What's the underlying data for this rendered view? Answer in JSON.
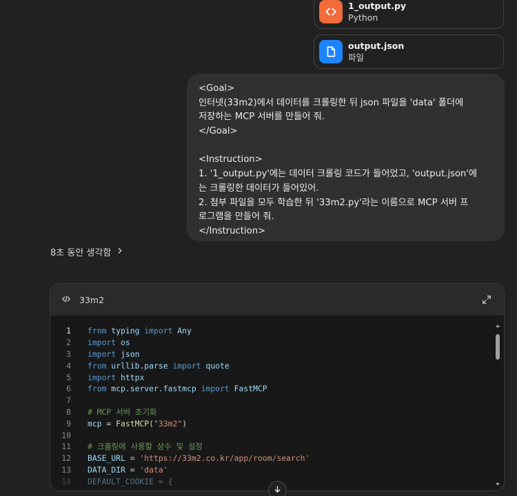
{
  "attachments": [
    {
      "name": "1_output.py",
      "type": "Python",
      "icon": "code-icon",
      "color": "#f26b3a"
    },
    {
      "name": "output.json",
      "type": "파일",
      "icon": "document-icon",
      "color": "#1d84ff"
    }
  ],
  "message": {
    "lines": [
      "<Goal>",
      "인터넷(33m2)에서 데이터를 크롤링한 뒤 json 파일을 'data' 폴더에",
      "저장하는 MCP 서버를 만들어 줘.",
      "</Goal>",
      "",
      "<Instruction>",
      "1. '1_output.py'에는 데이터 크롤링 코드가 들어었고, 'output.json'에",
      "는 크롤링한 데이터가 들어있어.",
      "2. 첨부 파일을 모두 학습한 뒤 '33m2.py'라는 이름으로 MCP 서버 프",
      "로그램을 만들어 줘.",
      "</Instruction>"
    ]
  },
  "thought": {
    "label": "8초 동안 생각함",
    "icon": "chevron-right-icon"
  },
  "code_block": {
    "title": "33m2",
    "header_icon": "code-icon",
    "expand_icon": "expand-icon",
    "lines": [
      {
        "num": "1",
        "text": "from typing import Any"
      },
      {
        "num": "2",
        "text": "import os"
      },
      {
        "num": "3",
        "text": "import json"
      },
      {
        "num": "4",
        "text": "from urllib.parse import quote"
      },
      {
        "num": "5",
        "text": "import httpx"
      },
      {
        "num": "6",
        "text": "from mcp.server.fastmcp import FastMCP"
      },
      {
        "num": "7",
        "text": ""
      },
      {
        "num": "8",
        "text": "# MCP 서버 초기화"
      },
      {
        "num": "9",
        "text": "mcp = FastMCP(\"33m2\")"
      },
      {
        "num": "10",
        "text": ""
      },
      {
        "num": "11",
        "text": "# 크롤링에 사용할 상수 및 설정"
      },
      {
        "num": "12",
        "text": "BASE_URL = 'https://33m2.co.kr/app/room/search'"
      },
      {
        "num": "13",
        "text": "DATA_DIR = 'data'"
      },
      {
        "num": "14",
        "text": "DEFAULT_COOKIE = {"
      }
    ]
  },
  "colors": {
    "background": "#212121",
    "bubble": "#303030",
    "code_background": "#181818",
    "keyword": "#569cd6",
    "comment": "#6a9955",
    "string": "#ce9178"
  },
  "scroll_down_icon": "arrow-down-icon"
}
